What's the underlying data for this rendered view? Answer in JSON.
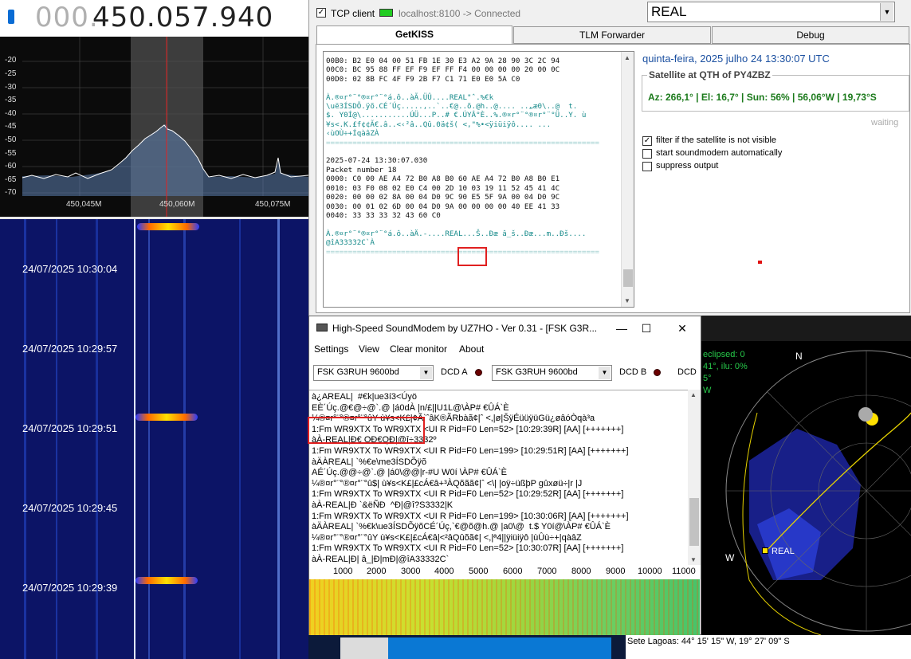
{
  "sdr": {
    "freq_dim": "000.",
    "freq_main": "450.057.940",
    "db_labels": [
      "-20",
      "-25",
      "-30",
      "-35",
      "-40",
      "-45",
      "-50",
      "-55",
      "-60",
      "-65",
      "-70"
    ],
    "freq_labels": [
      "450,045M",
      "450,060M",
      "450,075M"
    ],
    "waterfall_times": [
      "24/07/2025 10:30:04",
      "24/07/2025 10:29:57",
      "24/07/2025 10:29:51",
      "24/07/2025 10:29:45",
      "24/07/2025 10:29:39"
    ]
  },
  "getkiss": {
    "tcp_client_label": "TCP client",
    "tcp_checked": "✓",
    "connection_text": "localhost:8100 -> Connected",
    "satellite": "REAL",
    "tabs": [
      "GetKISS",
      "TLM Forwarder",
      "Debug"
    ],
    "monitor_lines": [
      {
        "t": "00B0: B2 E0 04 00 51 FB 1E 30 E3 A2 9A 28 90 3C 2C 94",
        "c": ""
      },
      {
        "t": "00C0: BC 95 88 FF EF F9 EF FF F4 00 00 00 00 20 00 0C",
        "c": ""
      },
      {
        "t": "00D0: 02 8B FC 4F F9 2B F7 C1 71 E0 E0 5A C0",
        "c": ""
      },
      {
        "t": "",
        "c": ""
      },
      {
        "t": "À.®¤r°¨°®¤r°¨°á.ô..àÃ.ÜÛ....REAL\"ˆ.%€k",
        "c": "cy"
      },
      {
        "t": "\\uë3ÍSDÕ.ÿõ.CÉ´Úç.....,..`..€@..õ.@h..@.... ..„æ0\\..@  t.",
        "c": "cy"
      },
      {
        "t": "$. Y0Í@\\...........ÚÜ...P..# €.ÚYÂ°È..%.®¤r°¨°®¤r°¨°Ü..Y. ù",
        "c": "cy"
      },
      {
        "t": "¥s<.K.£f¢¢Ã€.â..<‹²â..Qû.0ä¢š( <,\"%•<ÿiüiÿô.... ...",
        "c": "cy"
      },
      {
        "t": "‹ùOÙ÷+ÍqàâZÀ",
        "c": "cy"
      },
      {
        "t": "==============================================================",
        "c": "sep"
      },
      {
        "t": "",
        "c": ""
      },
      {
        "t": "2025-07-24 13:30:07.030",
        "c": ""
      },
      {
        "t": "Packet number 18",
        "c": ""
      },
      {
        "t": "0000: C0 00 AE A4 72 B0 A8 B0 60 AE A4 72 B0 A8 B0 E1",
        "c": ""
      },
      {
        "t": "0010: 03 F0 08 02 E0 C4 00 2D 10 03 19 11 52 45 41 4C",
        "c": ""
      },
      {
        "t": "0020: 00 00 02 8A 00 04 D0 9C 90 E5 5F 9A 00 04 D0 9C",
        "c": ""
      },
      {
        "t": "0030: 00 01 02 6D 00 04 D0 9A 00 00 00 00 40 EE 41 33",
        "c": ""
      },
      {
        "t": "0040: 33 33 33 32 43 60 C0",
        "c": ""
      },
      {
        "t": "",
        "c": ""
      },
      {
        "t": "À.®¤r°¨°®¤r°¨°á.ô..àÄ.-....REAL...Š..Ðæ â_š..Ðæ...m..Ðš....",
        "c": "cy"
      },
      {
        "t": "@îA33332C`À",
        "c": "cy"
      },
      {
        "t": "==============================================================",
        "c": "sep"
      }
    ],
    "datetime": "quinta-feira, 2025 julho 24  13:30:07 UTC",
    "sat_group_title": "Satellite at QTH of PY4ZBZ",
    "sat_info": "Az: 266,1° | El: 16,7° | Sun: 56% | 56,06°W | 19,73°S",
    "waiting": "waiting",
    "options": [
      {
        "label": "filter if the satellite is not visible",
        "checked": "✓"
      },
      {
        "label": "start soundmodem automatically",
        "checked": ""
      },
      {
        "label": "suppress output",
        "checked": ""
      }
    ]
  },
  "soundmodem": {
    "title": "High-Speed SoundModem by UZ7HO - Ver 0.31 - [FSK G3R...",
    "menu": [
      "Settings",
      "View",
      "Clear monitor",
      "About"
    ],
    "mode_a": "FSK G3RUH 9600bd",
    "mode_b": "FSK G3RUH 9600bd",
    "dcd_a": "DCD A",
    "dcd_b": "DCD B",
    "dcd_c": "DCD",
    "monitor_lines": [
      "à¿AREAL|  #€k|ue3í3<Úyö",
      "EÈ´Úç.@€@÷@`.@ |á0dÀ |n/£||U1L@\\ÀP# €ÛÁ`È",
      "¼®¤r°¨°®¤r°¨°ûY ù¥s<K£|¢Ã`ˆâK®ÃRbàã¢|ˆ <,|ø|ŠÿÉüüÿüGü¿øâóÒqà³a",
      "1:Fm WR9XTX To WR9XTX <UI R Pid=F0 Len=52> [10:29:39R] [AA] [+++++++]",
      "àÀ-REAL|Ð€ OÐ€QÐ|@î÷3332º",
      "1:Fm WR9XTX To WR9XTX <UI R Pid=F0 Len=199> [10:29:51R] [AA] [+++++++]",
      "àÄÀREAL| `%€e\\me3ÍSDÕÿõ",
      "AÉ´Úç.@@÷@`.@ |á0\\@@|r-#U W0í \\ÀP# €ÛÁ`È",
      "¼®¤r°¨°®¤r°¨°û$| ù¥s<K£|£cÁ€â+³ÀQõãã¢|ˆ <\\| |oÿ÷üßþP gûxøü÷|r |J",
      "1:Fm WR9XTX To WR9XTX <UI R Pid=F0 Len=52> [10:29:52R] [AA] [+++++++]",
      "àÀ-REAL|Ð `&ëÑÐ  ^Ð|@î?S3332|K",
      "1:Fm WR9XTX To WR9XTX <UI R Pid=F0 Len=199> [10:30:06R] [AA] [+++++++]",
      "àÄÀREAL| `%€k\\ue3ÍSDÕÿõCÉ´Úç,`€@õ@h.@ |a0\\@  t.$ Y0í@\\ÀP# €ÛÁ`È",
      "¼®¤r°¨°®¤r°¨°ûY ù¥s<K£|£cÁ€â|<²âQûõã¢| <,|ª4||ÿiüiÿô |ùÛù÷+|qàâZ",
      "1:Fm WR9XTX To WR9XTX <UI R Pid=F0 Len=52> [10:30:07R] [AA] [+++++++]",
      "àÀ-REAL|Ð| â_|Ð|mÐ|@îA33332C`"
    ],
    "freq_ticks": [
      "1000",
      "2000",
      "3000",
      "4000",
      "5000",
      "6000",
      "7000",
      "8000",
      "9000",
      "10000",
      "11000"
    ]
  },
  "map": {
    "info": "eclipsed: 0\n41°, ilu: 0%\n5°\nW",
    "north": "N",
    "west": "W",
    "sat_label": "REAL",
    "location": "Sete Lagoas: 44° 15' 15\" W, 19° 27' 09\" S"
  }
}
